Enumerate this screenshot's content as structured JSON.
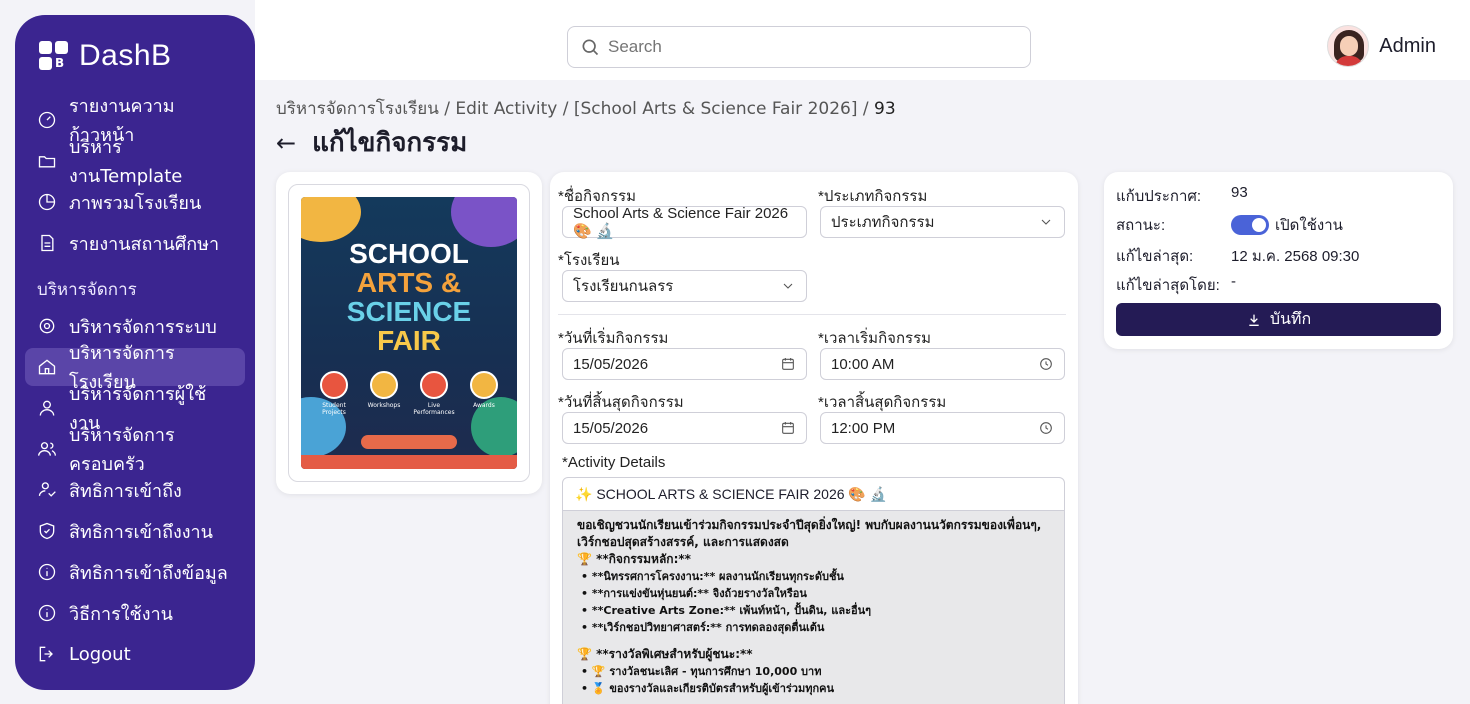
{
  "brand": {
    "name": "DashB",
    "logo_letter": "B"
  },
  "sidebar": {
    "items": [
      {
        "label": "รายงานความก้าวหน้า",
        "icon": "gauge-icon"
      },
      {
        "label": "บริหารงานTemplate",
        "icon": "folder-icon"
      },
      {
        "label": "ภาพรวมโรงเรียน",
        "icon": "pie-chart-icon"
      },
      {
        "label": "รายงานสถานศึกษา",
        "icon": "document-icon"
      }
    ],
    "section_label": "บริหารจัดการ",
    "admin_items": [
      {
        "label": "บริหารจัดการระบบ",
        "icon": "gear-icon"
      },
      {
        "label": "บริหารจัดการโรงเรียน",
        "icon": "home-icon",
        "active": true
      },
      {
        "label": "บริหารจัดการผู้ใช้งาน",
        "icon": "user-icon"
      },
      {
        "label": "บริหารจัดการครอบครัว",
        "icon": "users-icon"
      },
      {
        "label": "สิทธิการเข้าถึง",
        "icon": "user-access-icon"
      },
      {
        "label": "สิทธิการเข้าถึงงาน",
        "icon": "shield-icon"
      },
      {
        "label": "สิทธิการเข้าถึงข้อมูล",
        "icon": "info-icon"
      },
      {
        "label": "วิธีการใช้งาน",
        "icon": "help-icon"
      },
      {
        "label": "Logout",
        "icon": "logout-icon"
      }
    ]
  },
  "header": {
    "search_placeholder": "Search",
    "user_name": "Admin"
  },
  "breadcrumb": {
    "path": "บริหารจัดการโรงเรียน / Edit Activity / [School Arts & Science Fair 2026] / ",
    "current": "93"
  },
  "page": {
    "title": "แก้ไขกิจกรรม"
  },
  "poster": {
    "lines": [
      "SCHOOL",
      "ARTS &",
      "SCIENCE",
      "FAIR"
    ],
    "features": [
      "Student Projects",
      "Workshops",
      "Live Performances",
      "Awards"
    ]
  },
  "form": {
    "activity_name_label": "*ชื่อกิจกรรม",
    "activity_name_value": "School Arts & Science Fair 2026 🎨 🔬",
    "activity_type_label": "*ประเภทกิจกรรม",
    "activity_type_value": "ประเภทกิจกรรม",
    "school_label": "*โรงเรียน",
    "school_value": "โรงเรียนกนลรร",
    "start_date_label": "*วันที่เริ่มกิจกรรม",
    "start_date_value": "15/05/2026",
    "start_time_label": "*เวลาเริ่มกิจกรรม",
    "start_time_value": "10:00 AM",
    "end_date_label": "*วันที่สิ้นสุดกิจกรรม",
    "end_date_value": "15/05/2026",
    "end_time_label": "*เวลาสิ้นสุดกิจกรรม",
    "end_time_value": "12:00 PM",
    "details_label": "*Activity Details",
    "details_heading": "✨ SCHOOL ARTS & SCIENCE FAIR 2026 🎨 🔬",
    "details_intro": "ขอเชิญชวนนักเรียนเข้าร่วมกิจกรรมประจำปีสุดยิ่งใหญ่! พบกับผลงานนวัตกรรมของเพื่อนๆ, เวิร์กชอปสุดสร้างสรรค์, และการแสดงสด",
    "details_section1": "🏆 **กิจกรรมหลัก:**",
    "details_list1": [
      "• **นิทรรศการโครงงาน:** ผลงานนักเรียนทุกระดับชั้น",
      "• **การแข่งขันหุ่นยนต์:** จิงถ้วยรางวัลใหรือน",
      "• **Creative Arts Zone:** เพ้นท์หน้า, ปั้นดิน, และอื่นๆ",
      "• **เวิร์กชอปวิทยาศาสตร์:** การทดลองสุดตื่นเต้น"
    ],
    "details_section2": "🏆 **รางวัลพิเศษสำหรับผู้ชนะ:**",
    "details_list2": [
      "• 🏆 รางวัลชนะเลิศ - ทุนการศึกษา 10,000 บาท",
      "• 🏅 ของรางวัลและเกียรติบัตรสำหรับผู้เข้าร่วมทุกคน"
    ]
  },
  "meta": {
    "version_label": "แก้บประกาศ:",
    "version_value": "93",
    "status_label": "สถานะ:",
    "status_value": "เปิดใช้งาน",
    "status_on": true,
    "updated_label": "แก้ไขล่าสุด:",
    "updated_value": "12 ม.ค. 2568 09:30",
    "updated_by_label": "แก้ไขล่าสุดโดย:",
    "updated_by_value": "-",
    "save_label": "บันทึก"
  }
}
